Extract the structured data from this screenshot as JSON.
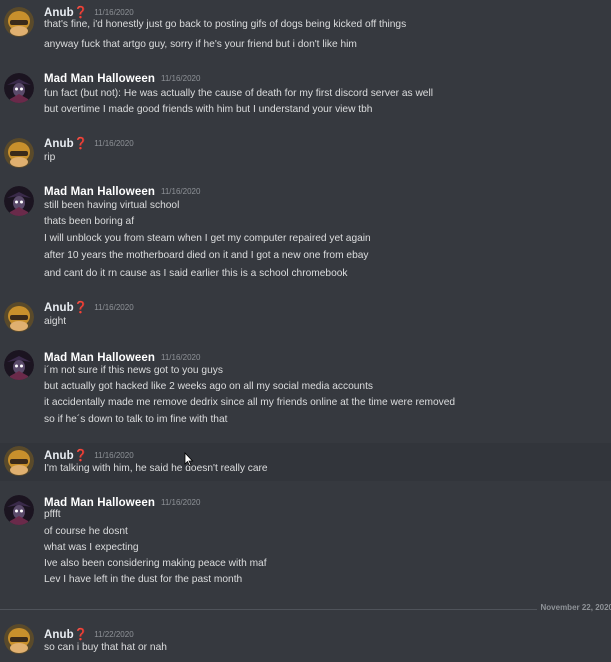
{
  "messages": [
    {
      "user": "Anub❓",
      "time": "11/16/2020",
      "lines": [
        "that's fine, i'd honestly just go back to posting gifs of dogs being kicked off things",
        "anyway fuck that artgo guy, sorry if he's your friend but i don't like him"
      ]
    },
    {
      "user": "Mad Man Halloween",
      "time": "11/16/2020",
      "lines": [
        "fun fact (but not): He was actually the cause of death for my first discord server as well",
        "but overtime I made good friends with him but I understand your view tbh"
      ]
    },
    {
      "user": "Anub❓",
      "time": "11/16/2020",
      "lines": [
        "rip"
      ]
    },
    {
      "user": "Mad Man Halloween",
      "time": "11/16/2020",
      "lines": [
        "still been having virtual school",
        "thats been boring af",
        "I will unblock you from steam when I get my computer repaired yet again",
        "after 10 years the motherboard died on it and I got a new one from ebay",
        "and cant do it rn cause as I said earlier this is a school chromebook"
      ]
    },
    {
      "user": "Anub❓",
      "time": "11/16/2020",
      "lines": [
        "aight"
      ]
    },
    {
      "user": "Mad Man Halloween",
      "time": "11/16/2020",
      "lines": [
        "i´m not sure if this news got to you guys",
        "but actually got hacked like 2 weeks ago on all my social media accounts",
        "it accidentally made me remove dedrix since all my friends online at the time were removed",
        " so if he´s down to talk to im fine with that"
      ]
    },
    {
      "user": "Anub❓",
      "time": "11/16/2020",
      "lines": [
        "I'm talking with him, he said he doesn't really care"
      ]
    },
    {
      "user": "Mad Man Halloween",
      "time": "11/16/2020",
      "lines": [
        "pffft",
        "of course he dosnt",
        "what was I expecting",
        "Ive also been considering making peace with maf",
        "Lev I have left in the dust for the past month"
      ]
    },
    {
      "user": "Anub❓",
      "time": "11/22/2020",
      "lines": [
        "so can i buy that hat or nah"
      ]
    }
  ],
  "divider": {
    "label": "November 22, 2020"
  },
  "colors": {
    "background": "#36393f",
    "hover_background": "#32353b",
    "username": "#ffffff",
    "message_text": "#dcddde",
    "timestamp": "#8e9297"
  }
}
